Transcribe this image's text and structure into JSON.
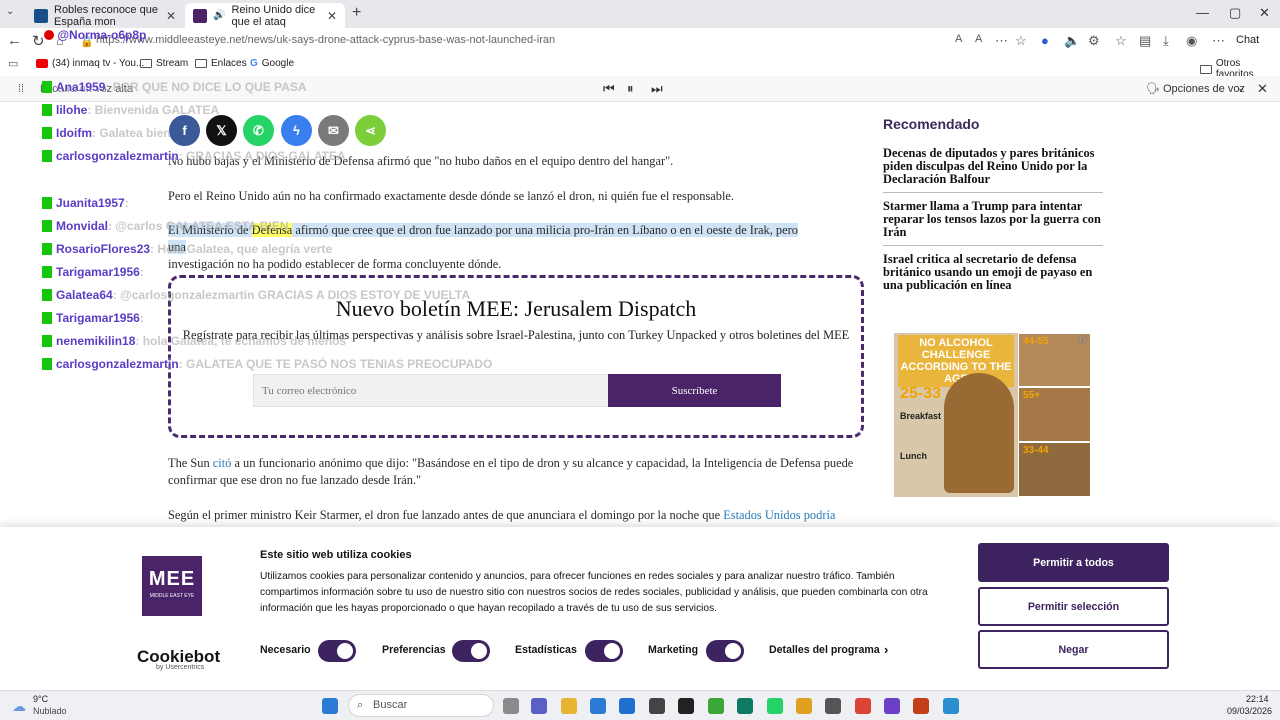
{
  "browser": {
    "tabs": [
      {
        "label": "Robles reconoce que España mon"
      },
      {
        "label": "Reino Unido dice que el ataq"
      }
    ],
    "url": "https://www.middleeasteye.net/news/uk-says-drone-attack-cyprus-base-was-not-launched-iran",
    "chat_label": "Chat",
    "favorites": [
      {
        "label": "(34) inmaq tv - You..."
      },
      {
        "label": "Stream"
      },
      {
        "label": "Enlaces"
      },
      {
        "label": "Google"
      }
    ],
    "other_favorites": "Otros favoritos"
  },
  "read_aloud": {
    "label": "Lectura en voz alta",
    "voice_options": "Opciones de voz"
  },
  "article": {
    "p1": "No hubo bajas y el Ministerio de Defensa afirmó que \"no hubo daños en el equipo dentro del hangar\".",
    "p2": "Pero el Reino Unido aún no ha confirmado exactamente desde dónde se lanzó el dron, ni quién fue el responsable.",
    "p3_hl1": "El Ministerio de ",
    "p3_hly": "Defensa",
    "p3_hl2": " afirmó que cree que el dron fue lanzado por una milicia pro-Irán en Líbano o en el oeste de Irak, pero una",
    "p3_rest": "investigación no ha podido establecer de forma concluyente dónde.",
    "p4_pre": "The Sun ",
    "p4_link": "citó",
    "p4_post": " a un funcionario anónimo que dijo: \"Basándose en el tipo de dron y su alcance y capacidad, la Inteligencia de Defensa puede confirmar que ese dron no fue lanzado desde Irán.\"",
    "p5_pre": "Según el primer ministro Keir Starmer, el dron fue lanzado antes de que anunciara el domingo por la noche que ",
    "p5_link": "Estados Unidos podría"
  },
  "newsletter": {
    "title": "Nuevo boletín MEE: Jerusalem Dispatch",
    "text": "Regístrate para recibir las últimas perspectivas y análisis sobre Israel-Palestina, junto con Turkey Unpacked y otros boletines del MEE",
    "placeholder": "Tu correo electrónico",
    "button": "Suscríbete"
  },
  "sidebar": {
    "title": "Recomendado",
    "items": [
      "Decenas de diputados y pares británicos piden disculpas del Reino Unido por la Declaración Balfour",
      "Starmer llama a Trump para intentar reparar los tensos lazos por la guerra con Irán",
      "Israel critica al secretario de defensa británico usando un emoji de payaso en una publicación en línea"
    ],
    "ad": {
      "headline": "NO ALCOHOL CHALLENGE ACCORDING TO THE AGE",
      "range1": "25-33",
      "range2": "44-55",
      "range3": "55+",
      "range4": "33-44",
      "meal1": "Breakfast",
      "meal2": "Lunch"
    }
  },
  "chat_overlay": {
    "header_user": "@Norma-o6p8p",
    "lines": [
      {
        "user": "Ana1959",
        "msg": ": POR QUE NO DICE LO QUE PASA"
      },
      {
        "user": "lilohe",
        "msg": ": Bienvenida GALATEA"
      },
      {
        "user": "Idoifm",
        "msg": ": Galatea bien"
      },
      {
        "user": "carlosgonzalezmartin",
        "msg": ": GRACIAS A DIOS GALATEA"
      },
      {
        "user": "Juanita1957",
        "msg": ":"
      },
      {
        "user": "Monvidal",
        "msg": ": @carlos GALATEA ESTA BIEN"
      },
      {
        "user": "RosarioFlores23",
        "msg": ": Hola Galatea, que alegría verte"
      },
      {
        "user": "Tarigamar1956",
        "msg": ":"
      },
      {
        "user": "Galatea64",
        "msg": ": @carlosgonzalezmartin GRACIAS A DIOS ESTOY DE VUELTA"
      },
      {
        "user": "Tarigamar1956",
        "msg": ":"
      },
      {
        "user": "nenemikilin18",
        "msg": ": hola Galatea, te echamos de menos"
      },
      {
        "user": "carlosgonzalezmartin",
        "msg": ": GALATEA QUE TE PASÓ NOS TENIAS PREOCUPADO"
      }
    ]
  },
  "cookies": {
    "title": "Este sitio web utiliza cookies",
    "text": "Utilizamos cookies para personalizar contenido y anuncios, para ofrecer funciones en redes sociales y para analizar nuestro tráfico. También compartimos información sobre tu uso de nuestro sitio con nuestros socios de redes sociales, publicidad y análisis, que pueden combinarla con otra información que les hayas proporcionado o que hayan recopilado a través de tu uso de sus servicios.",
    "toggles": [
      "Necesario",
      "Preferencias",
      "Estadísticas",
      "Marketing"
    ],
    "details": "Detalles del programa",
    "allow_all": "Permitir a todos",
    "allow_selection": "Permitir selección",
    "deny": "Negar",
    "brand": "Cookiebot",
    "brand_sub": "by Usercentrics",
    "logo_text": "MEE",
    "logo_sub": "MIDDLE EAST EYE"
  },
  "taskbar": {
    "temp": "9°C",
    "weather": "Nublado",
    "search": "Buscar",
    "time": "22:14",
    "date": "09/03/2026"
  },
  "colors": {
    "brand": "#4a2368",
    "link": "#2a7ab8",
    "chat_user": "#5b3cc4"
  }
}
